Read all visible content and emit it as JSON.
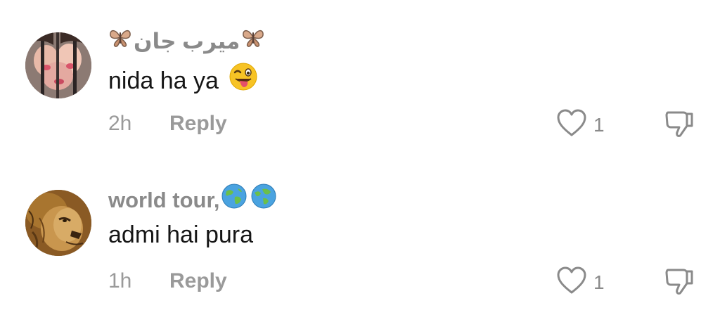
{
  "comments": [
    {
      "username": "میرب جان",
      "username_decor_icon": "butterfly-icon",
      "text": "nida ha ya",
      "text_emoji_icon": "winking-tongue-face-emoji",
      "time": "2h",
      "reply_label": "Reply",
      "like_count": "1",
      "avatar_icon": "avatar-girl-photo"
    },
    {
      "username": "world tour,",
      "username_decor_icon": "globe-icon",
      "text": "admi hai pura",
      "time": "1h",
      "reply_label": "Reply",
      "like_count": "1",
      "avatar_icon": "avatar-lion-photo"
    }
  ],
  "colors": {
    "username": "#8a8a8a",
    "text": "#161616",
    "meta": "#9a9a9a",
    "icon_stroke": "#8a8a8a"
  }
}
